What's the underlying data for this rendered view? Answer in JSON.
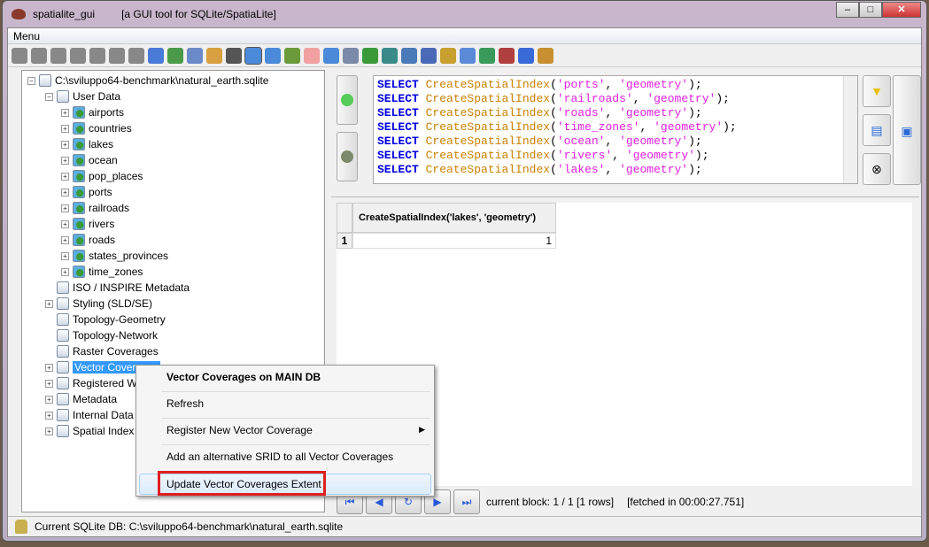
{
  "window": {
    "app": "spatialite_gui",
    "subtitle": "[a GUI tool for SQLite/SpatiaLite]",
    "min": "–",
    "max": "□",
    "close": "✕"
  },
  "menu": {
    "label": "Menu"
  },
  "toolbar": {
    "icons": [
      "connect-icon",
      "disconnect-icon",
      "create-db-icon",
      "memory-db-icon",
      "memory-load-icon",
      "memory-save-icon",
      "memory-export-icon",
      "attach-icon",
      "vacuum-icon",
      "sql-script-icon",
      "load-shp-icon",
      "virtual-shp-icon",
      "load-txt-icon",
      "virtual-txt-icon",
      "check-geom-icon",
      "sanitize-icon",
      "load-dbf-icon",
      "virtual-dbf-icon",
      "load-xl-icon",
      "virtual-xl-icon",
      "network-icon",
      "exif-icon",
      "gps-icon",
      "srids-icon",
      "charset-icon",
      "help-icon",
      "about-icon",
      "exit-icon"
    ]
  },
  "tree": {
    "root": "C:\\sviluppo64-benchmark\\natural_earth.sqlite",
    "user_data": "User Data",
    "tables": [
      "airports",
      "countries",
      "lakes",
      "ocean",
      "pop_places",
      "ports",
      "railroads",
      "rivers",
      "roads",
      "states_provinces",
      "time_zones"
    ],
    "groups": [
      "ISO / INSPIRE Metadata",
      "Styling (SLD/SE)",
      "Topology-Geometry",
      "Topology-Network",
      "Raster Coverages",
      "Vector Coverages",
      "Registered WMS",
      "Metadata",
      "Internal Data",
      "Spatial Index"
    ]
  },
  "sql": {
    "lines": [
      [
        "SELECT",
        "CreateSpatialIndex",
        "'ports'",
        "'geometry'"
      ],
      [
        "SELECT",
        "CreateSpatialIndex",
        "'railroads'",
        "'geometry'"
      ],
      [
        "SELECT",
        "CreateSpatialIndex",
        "'roads'",
        "'geometry'"
      ],
      [
        "SELECT",
        "CreateSpatialIndex",
        "'time_zones'",
        "'geometry'"
      ],
      [
        "SELECT",
        "CreateSpatialIndex",
        "'ocean'",
        "'geometry'"
      ],
      [
        "SELECT",
        "CreateSpatialIndex",
        "'rivers'",
        "'geometry'"
      ],
      [
        "SELECT",
        "CreateSpatialIndex",
        "'lakes'",
        "'geometry'"
      ]
    ]
  },
  "results": {
    "column": "CreateSpatialIndex('lakes', 'geometry')",
    "rows": [
      {
        "n": "1",
        "value": "1"
      }
    ],
    "block": "current block: 1 / 1 [1 rows]",
    "fetched": "[fetched in 00:00:27.751]"
  },
  "context_menu": {
    "title": "Vector Coverages on MAIN DB",
    "items": [
      "Refresh",
      "Register New Vector Coverage",
      "Add an alternative SRID to all Vector Coverages",
      "Update Vector Coverages Extent"
    ],
    "submenu_arrow": "▶",
    "highlight_color": "#e02020"
  },
  "status": {
    "text": "Current SQLite DB: C:\\sviluppo64-benchmark\\natural_earth.sqlite"
  }
}
